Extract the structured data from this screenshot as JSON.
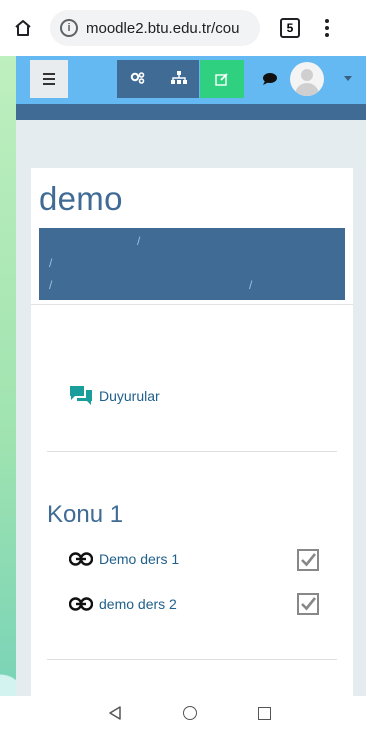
{
  "browser": {
    "url": "moodle2.btu.edu.tr/cou",
    "tab_count": "5"
  },
  "course": {
    "title": "demo"
  },
  "forum": {
    "label": "Duyurular"
  },
  "section": {
    "title": "Konu 1",
    "activities": [
      {
        "label": "Demo ders 1",
        "completed": true
      },
      {
        "label": "demo ders 2",
        "completed": true
      }
    ]
  },
  "colors": {
    "navbar": "#64b9f2",
    "brand_dark": "#3f6b95",
    "edit_green": "#2fd181",
    "link": "#1f5f8b",
    "forum_icon": "#1a9e9b"
  }
}
